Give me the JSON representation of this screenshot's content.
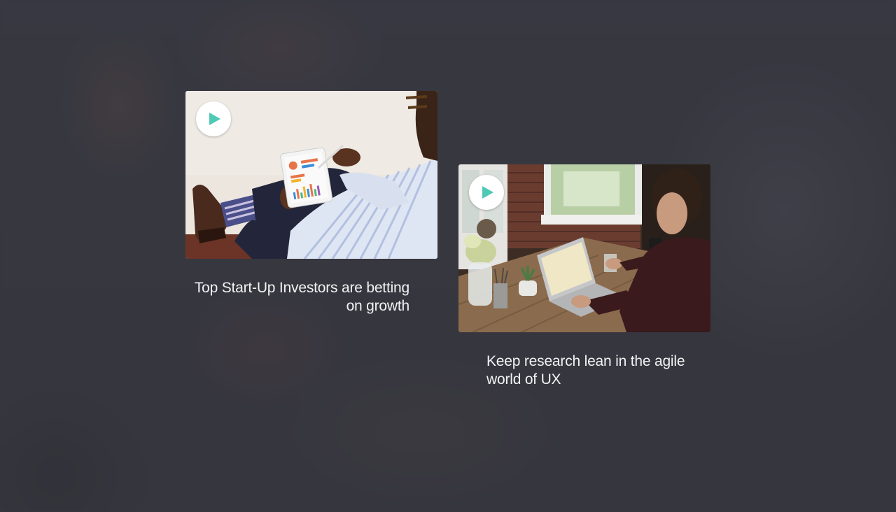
{
  "cards": [
    {
      "title": "Top Start-Up Investors are betting on growth",
      "play_icon": "play-icon",
      "image": "man-with-tablet-charts-photo"
    },
    {
      "title": "Keep research lean in the agile world of UX",
      "play_icon": "play-icon",
      "image": "man-working-on-laptop-photo"
    }
  ],
  "colors": {
    "accent": "#4dc9b5",
    "overlay": "#34343e",
    "title_text": "#f2f2f4"
  }
}
